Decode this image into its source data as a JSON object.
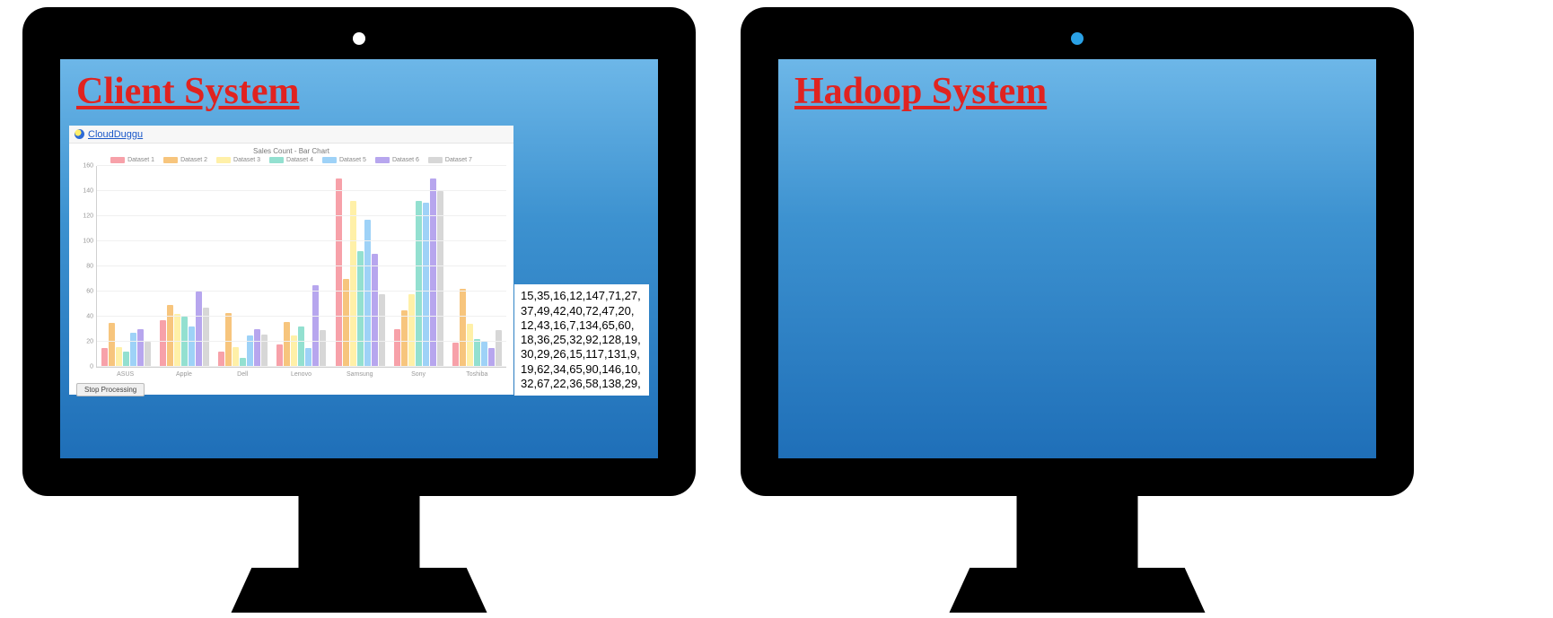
{
  "left_title": "Client System",
  "right_title": "Hadoop System",
  "dashboard": {
    "brand": "CloudDuggu",
    "stop_button": "Stop Processing"
  },
  "data_box": "15,35,16,12,147,71,27,\n37,49,42,40,72,47,20,\n12,43,16,7,134,65,60,\n18,36,25,32,92,128,19,\n30,29,26,15,117,131,9,\n19,62,34,65,90,146,10,\n32,67,22,36,58,138,29,",
  "chart_data": {
    "type": "bar",
    "title": "Sales Count - Bar Chart",
    "ylabel": "",
    "xlabel": "",
    "ylim": [
      0,
      160
    ],
    "yticks": [
      0,
      20,
      40,
      60,
      80,
      100,
      120,
      140,
      160
    ],
    "categories": [
      "ASUS",
      "Apple",
      "Dell",
      "Lenovo",
      "Samsung",
      "Sony",
      "Toshiba"
    ],
    "series": [
      {
        "name": "Dataset 1",
        "color": "#f7a1a9",
        "values": [
          15,
          37,
          12,
          18,
          150,
          30,
          19
        ]
      },
      {
        "name": "Dataset 2",
        "color": "#f7c57d",
        "values": [
          35,
          49,
          43,
          36,
          70,
          45,
          62
        ]
      },
      {
        "name": "Dataset 3",
        "color": "#fff0a8",
        "values": [
          16,
          42,
          16,
          25,
          132,
          58,
          34
        ]
      },
      {
        "name": "Dataset 4",
        "color": "#93e0d0",
        "values": [
          12,
          40,
          7,
          32,
          92,
          132,
          22
        ]
      },
      {
        "name": "Dataset 5",
        "color": "#9ed2f7",
        "values": [
          27,
          32,
          25,
          15,
          117,
          131,
          20
        ]
      },
      {
        "name": "Dataset 6",
        "color": "#b7a6ee",
        "values": [
          30,
          60,
          30,
          65,
          90,
          150,
          15
        ]
      },
      {
        "name": "Dataset 7",
        "color": "#d7d7d7",
        "values": [
          20,
          47,
          26,
          29,
          58,
          140,
          29
        ]
      }
    ]
  }
}
